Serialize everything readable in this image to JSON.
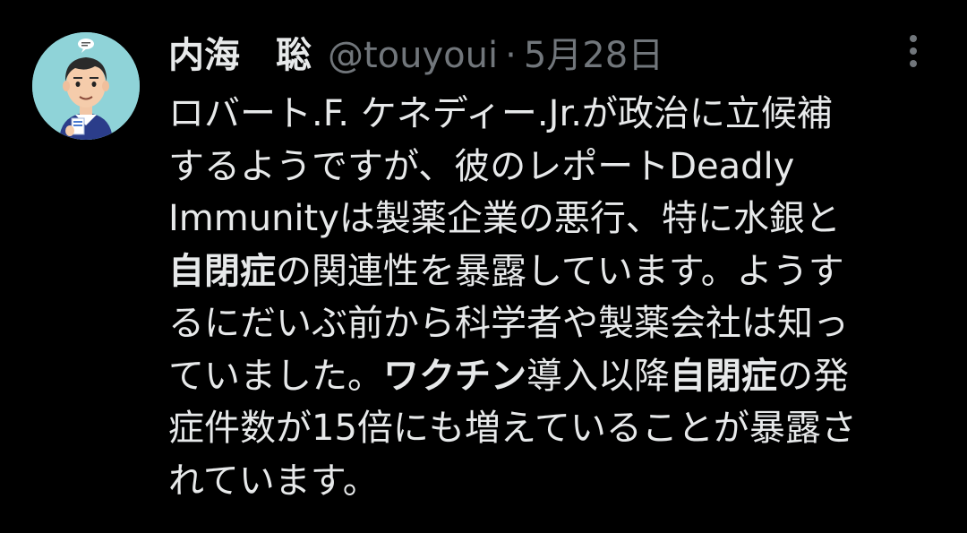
{
  "tweet": {
    "author": {
      "display_name": "内海　聡",
      "handle": "@touyoui",
      "avatar_icon": "cartoon-doctor-avatar"
    },
    "separator": "·",
    "timestamp": "5月28日",
    "more_icon": "more-vertical-icon",
    "text_lines": [
      [
        {
          "text": "ロバート.F. ケネディー.Jr.が政治に立候補",
          "bold": false
        }
      ],
      [
        {
          "text": "するようですが、彼のレポートDeadly",
          "bold": false
        }
      ],
      [
        {
          "text": "Immunityは製薬企業の悪行、特に水銀と",
          "bold": false
        }
      ],
      [
        {
          "text": "自閉症",
          "bold": true
        },
        {
          "text": "の関連性を暴露しています。ようす",
          "bold": false
        }
      ],
      [
        {
          "text": "るにだいぶ前から科学者や製薬会社は知っ",
          "bold": false
        }
      ],
      [
        {
          "text": "ていました。",
          "bold": false
        },
        {
          "text": "ワクチン",
          "bold": true
        },
        {
          "text": "導入以降",
          "bold": false
        },
        {
          "text": "自閉症",
          "bold": true
        },
        {
          "text": "の発",
          "bold": false
        }
      ],
      [
        {
          "text": "症件数が15倍にも増えていることが暴露さ",
          "bold": false
        }
      ],
      [
        {
          "text": "れています。",
          "bold": false
        }
      ]
    ]
  },
  "colors": {
    "background": "#000000",
    "primary_text": "#e7e9ea",
    "secondary_text": "#71767b",
    "avatar_bg": "#8fd3d8"
  }
}
